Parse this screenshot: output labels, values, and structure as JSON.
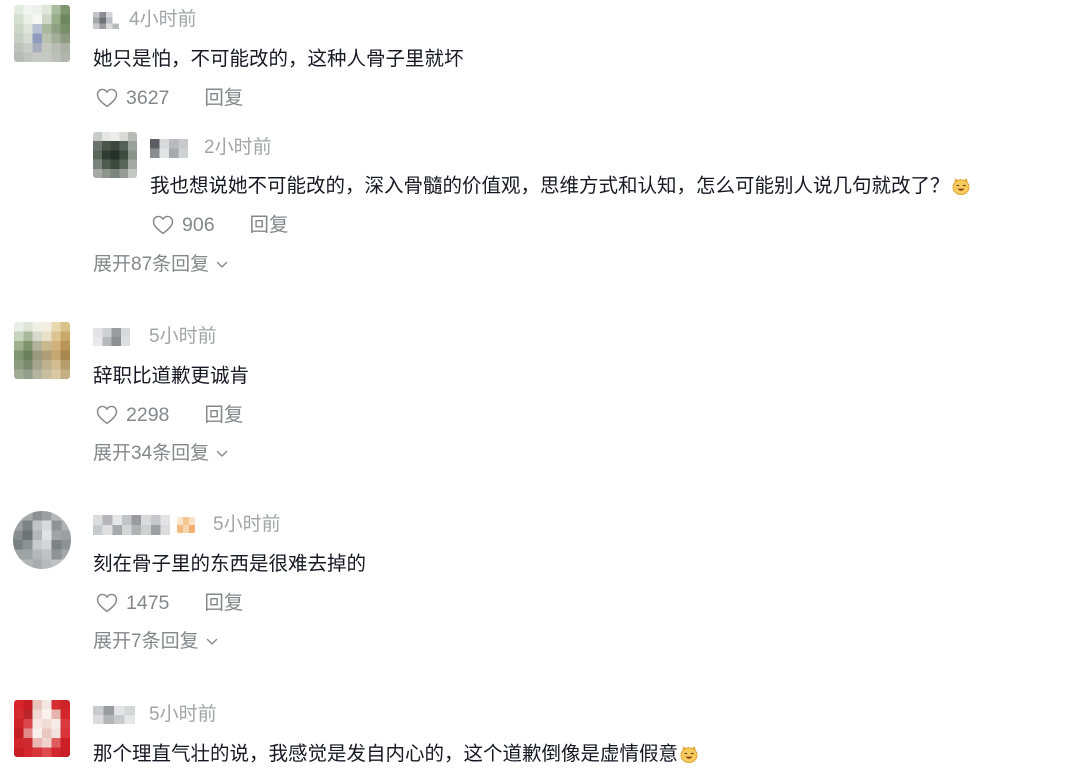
{
  "colors": {
    "primary_text": "#161823",
    "secondary_text": "#86878c",
    "time_text": "#a3a4a8",
    "page_background": "#ffffff"
  },
  "icons": {
    "like": "heart-outline-icon",
    "expand": "chevron-down-icon",
    "emoji": "grinning-cat-emoji"
  },
  "comments": [
    {
      "time": "4小时前",
      "text": "她只是怕，不可能改的，这种人骨子里就坏",
      "likes": "3627",
      "reply_label": "回复",
      "replies": [
        {
          "time": "2小时前",
          "text": "我也想说她不可能改的，深入骨髓的价值观，思维方式和认知，怎么可能别人说几句就改了？",
          "emoji": "grinning-cat-emoji",
          "likes": "906",
          "reply_label": "回复"
        }
      ],
      "expand_label": "展开87条回复"
    },
    {
      "time": "5小时前",
      "text": "辞职比道歉更诚肯",
      "likes": "2298",
      "reply_label": "回复",
      "expand_label": "展开34条回复"
    },
    {
      "time": "5小时前",
      "text": "刻在骨子里的东西是很难去掉的",
      "likes": "1475",
      "reply_label": "回复",
      "expand_label": "展开7条回复"
    },
    {
      "time": "5小时前",
      "text": "那个理直气壮的说，我感觉是发自内心的，这个道歉倒像是虚情假意",
      "emoji": "grinning-cat-emoji"
    }
  ]
}
